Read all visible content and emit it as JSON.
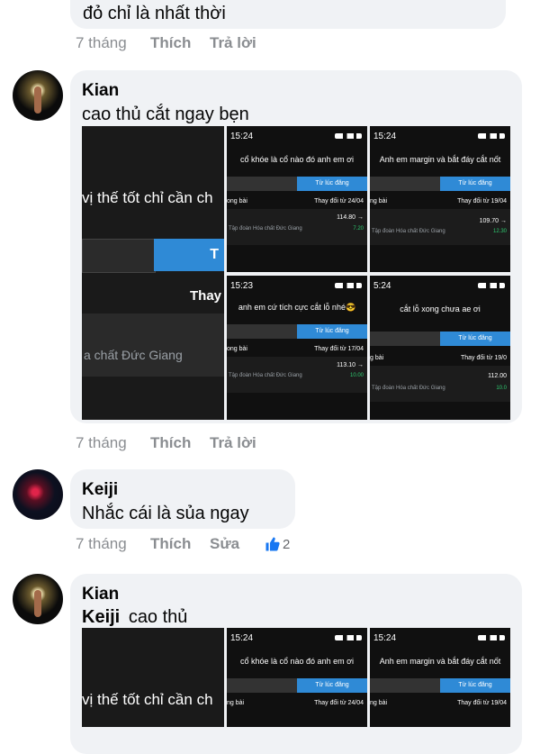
{
  "top_comment": {
    "text": "đỏ chỉ là nhất thời",
    "time": "7 tháng",
    "like": "Thích",
    "reply": "Trả lời"
  },
  "comment_kian_1": {
    "author": "Kian",
    "text": "cao thủ cắt ngay bẹn",
    "time": "7 tháng",
    "like": "Thích",
    "reply": "Trả lời",
    "big_tile": {
      "line1": "vị thế tốt chỉ cần ch",
      "tab": "T",
      "thay": "Thay",
      "company": "a chất Đức Giang"
    },
    "phones": [
      {
        "time": "15:24",
        "title": "cổ khóe là cổ nào đó anh em ơi",
        "tab": "Từ lúc đăng",
        "row1": "ong bài",
        "row1r": "Thay đổi từ 24/04",
        "num": "114.80 →",
        "company": "Tập đoàn Hóa chất Đức Giang",
        "pct": "7.20"
      },
      {
        "time": "15:24",
        "title": "Anh em margin và bắt đáy cắt nốt",
        "tab": "Từ lúc đăng",
        "row1": "ng bài",
        "row1r": "Thay đổi từ 19/04",
        "num": "109.70 →",
        "company": "Tập đoàn Hóa chất Đức Giang",
        "pct": "12.30"
      },
      {
        "time": "15:23",
        "title": "anh em cứ tích cực cắt lỗ nhé😎",
        "tab": "Từ lúc đăng",
        "row1": "ong bài",
        "row1r": "Thay đổi từ 17/04",
        "num": "113.10 →",
        "company": "Tập đoàn Hóa chất Đức Giang",
        "pct": "10.00"
      },
      {
        "time": "5:24",
        "title": "cắt lỗ xong chưa ae ơi",
        "tab": "Từ lúc đăng",
        "row1": "g bài",
        "row1r": "Thay đổi từ 19/0",
        "num": "112.00",
        "company": "Tập đoàn Hóa chất Đức Giang",
        "pct": "10.0"
      }
    ]
  },
  "comment_keiji": {
    "author": "Keiji",
    "text": "Nhắc cái là sủa ngay",
    "time": "7 tháng",
    "like": "Thích",
    "edit": "Sửa",
    "reaction_count": "2"
  },
  "comment_kian_2": {
    "author": "Kian",
    "mention": "Keiji",
    "text": "cao thủ",
    "big_tile": {
      "line1": "vị thế tốt chỉ cần ch"
    },
    "phones": [
      {
        "time": "15:24",
        "title": "cổ khóe là cổ nào đó anh em ơi",
        "tab": "Từ lúc đăng",
        "row1": "ng bài",
        "row1r": "Thay đổi từ 24/04"
      },
      {
        "time": "15:24",
        "title": "Anh em margin và bắt đáy cắt nốt",
        "tab": "Từ lúc đăng",
        "row1": "ng bài",
        "row1r": "Thay đổi từ 19/04"
      }
    ]
  },
  "colors": {
    "bubble": "#f0f2f5",
    "meta": "#8a8d91",
    "blue_tab": "#2f8ad6",
    "like_blue": "#1877f2"
  }
}
